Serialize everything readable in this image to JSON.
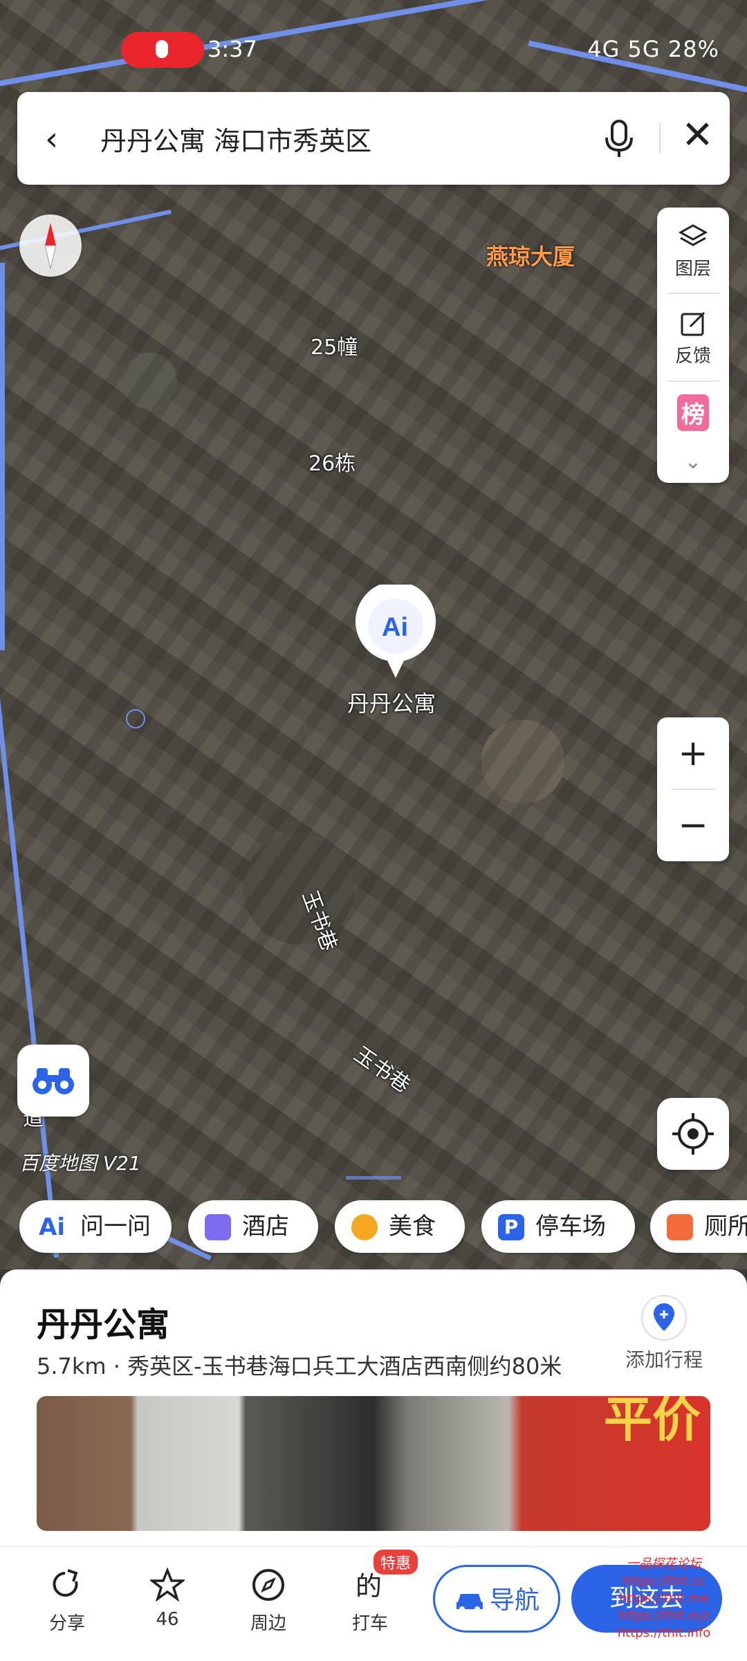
{
  "status_bar": {
    "time": "3:37",
    "right_text": "4G 5G 28%"
  },
  "search": {
    "query": "丹丹公寓 海口市秀英区"
  },
  "side_panel": {
    "layers_label": "图层",
    "feedback_label": "反馈",
    "rank_label": "榜"
  },
  "map": {
    "labels": {
      "building_yanqiong": "燕琼大厦",
      "bldg_25": "25幢",
      "bldg_26": "26栋",
      "street_1": "玉书巷",
      "street_2": "玉书巷",
      "road_left": "大道",
      "brand": "百度地图 V21"
    },
    "pin": {
      "icon_text": "Ai",
      "label": "丹丹公寓"
    }
  },
  "chips": [
    {
      "label": "问一问",
      "icon": "ai-icon",
      "color": "#2c64e8"
    },
    {
      "label": "酒店",
      "icon": "hotel-icon",
      "color": "#7b6cf0"
    },
    {
      "label": "美食",
      "icon": "food-icon",
      "color": "#f5a623"
    },
    {
      "label": "停车场",
      "icon": "parking-icon",
      "color": "#2c64e8"
    },
    {
      "label": "厕所",
      "icon": "toilet-icon",
      "color": "#f26b3a"
    }
  ],
  "place": {
    "name": "丹丹公寓",
    "detail": "5.7km · 秀英区-玉书巷海口兵工大酒店西南侧约80米",
    "add_trip": "添加行程",
    "photo_sign": "平价"
  },
  "bottom_bar": {
    "share": "分享",
    "favorite_count": "46",
    "nearby": "周边",
    "taxi": "打车",
    "taxi_badge": "特惠",
    "navigate": "导航",
    "go_there": "到这去"
  },
  "watermark": {
    "line1": "一品探花论坛",
    "line2": "https://thlt.cc",
    "line3": "https://thlt.me",
    "line4": "https://thlt.xyz",
    "line5": "https://thlt.info"
  }
}
